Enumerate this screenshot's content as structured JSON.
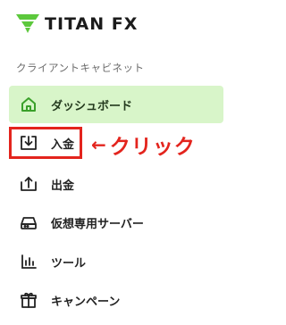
{
  "brand": {
    "name": "TITAN FX",
    "accent_color": "#5cc83c"
  },
  "sidebar": {
    "section_title": "クライアントキャビネット",
    "items": [
      {
        "label": "ダッシュボード",
        "icon": "home-icon",
        "active": true
      },
      {
        "label": "入金",
        "icon": "deposit-icon",
        "active": false
      },
      {
        "label": "出金",
        "icon": "withdraw-icon",
        "active": false
      },
      {
        "label": "仮想専用サーバー",
        "icon": "server-icon",
        "active": false
      },
      {
        "label": "ツール",
        "icon": "chart-bars-icon",
        "active": false
      },
      {
        "label": "キャンペーン",
        "icon": "gift-icon",
        "active": false
      }
    ]
  },
  "annotation": {
    "arrow": "←",
    "text": "クリック",
    "color": "#e3241d"
  }
}
